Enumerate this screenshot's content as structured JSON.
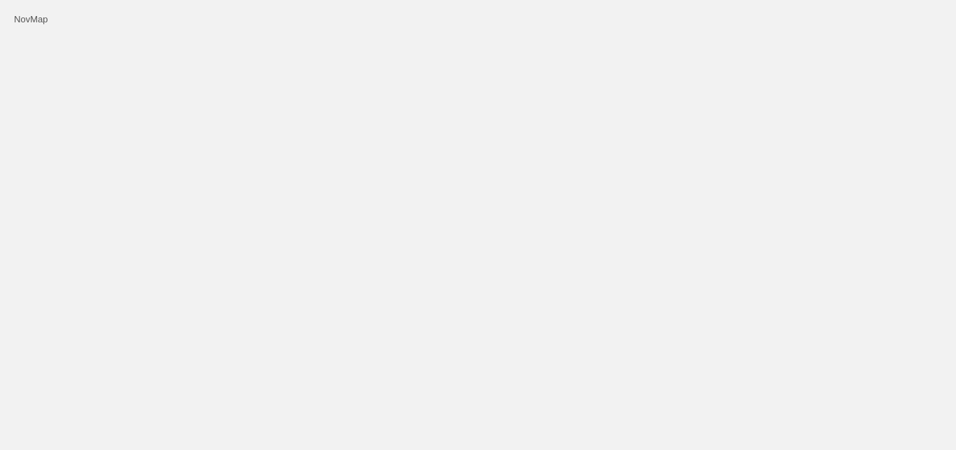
{
  "app": {
    "title": "NovMap"
  }
}
